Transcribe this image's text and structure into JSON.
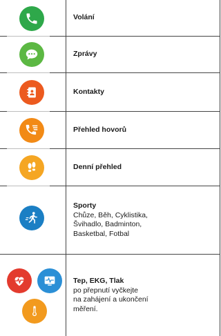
{
  "colors": {
    "green": "#2ea84a",
    "lime_green": "#5cb843",
    "orange_red": "#ec5a1f",
    "orange": "#f28a16",
    "yellow_orange": "#f5a623",
    "blue": "#1b7fc4",
    "red": "#e33b2e",
    "light_blue": "#2b8fd6",
    "amber": "#f29a1e"
  },
  "rows": [
    {
      "icon": "phone-icon",
      "title": "Volání"
    },
    {
      "icon": "chat-bubble-icon",
      "title": "Zprávy"
    },
    {
      "icon": "contacts-book-icon",
      "title": "Kontakty"
    },
    {
      "icon": "call-log-icon",
      "title": "Přehled hovorů"
    },
    {
      "icon": "footprints-icon",
      "title": "Denní přehled"
    },
    {
      "icon": "running-person-icon",
      "title": "Sporty",
      "desc": [
        "Chůze, Běh, Cyklistika,",
        "Švihadlo, Badminton,",
        "Basketbal, Fotbal"
      ]
    },
    {
      "icons": [
        "heart-rate-icon",
        "ecg-monitor-icon",
        "thermometer-icon"
      ],
      "title": "Tep, EKG, Tlak",
      "desc": [
        "po přepnutí vyčkejte",
        "na zahájení a ukončení",
        "měření."
      ]
    }
  ]
}
